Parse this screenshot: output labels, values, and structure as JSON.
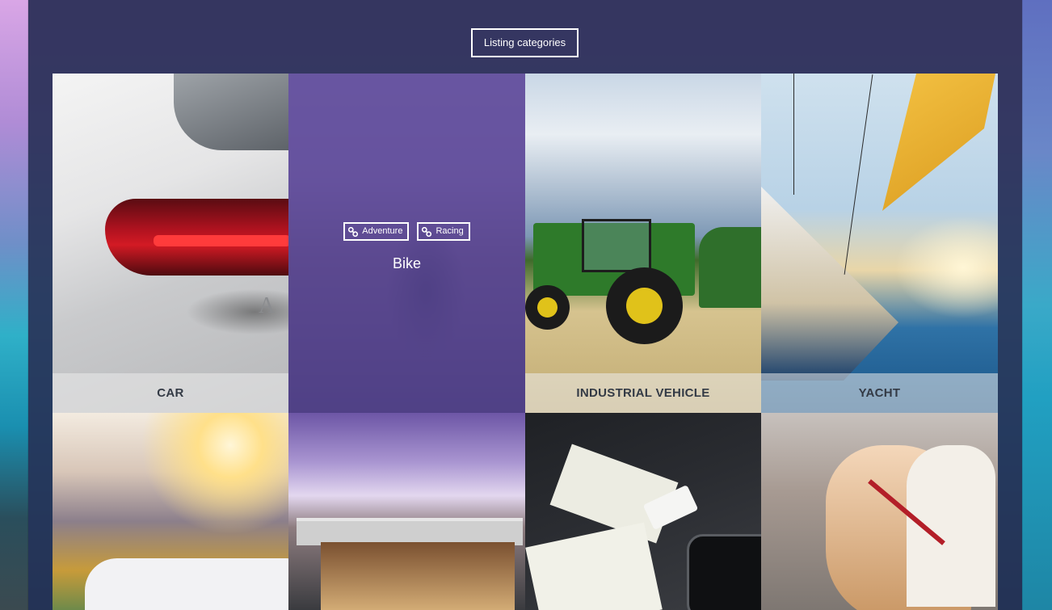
{
  "section": {
    "title": "Listing categories"
  },
  "categories": [
    {
      "label": "CAR"
    },
    {
      "label": "Bike",
      "tags": [
        "Adventure",
        "Racing"
      ]
    },
    {
      "label": "INDUSTRIAL VEHICLE"
    },
    {
      "label": "YACHT"
    },
    {
      "label": ""
    },
    {
      "label": ""
    },
    {
      "label": ""
    },
    {
      "label": ""
    }
  ],
  "icons": {
    "tag": "link-icon"
  },
  "colors": {
    "overlay": "#584698",
    "container": "#282c52",
    "label_bar": "#ebebeb"
  }
}
